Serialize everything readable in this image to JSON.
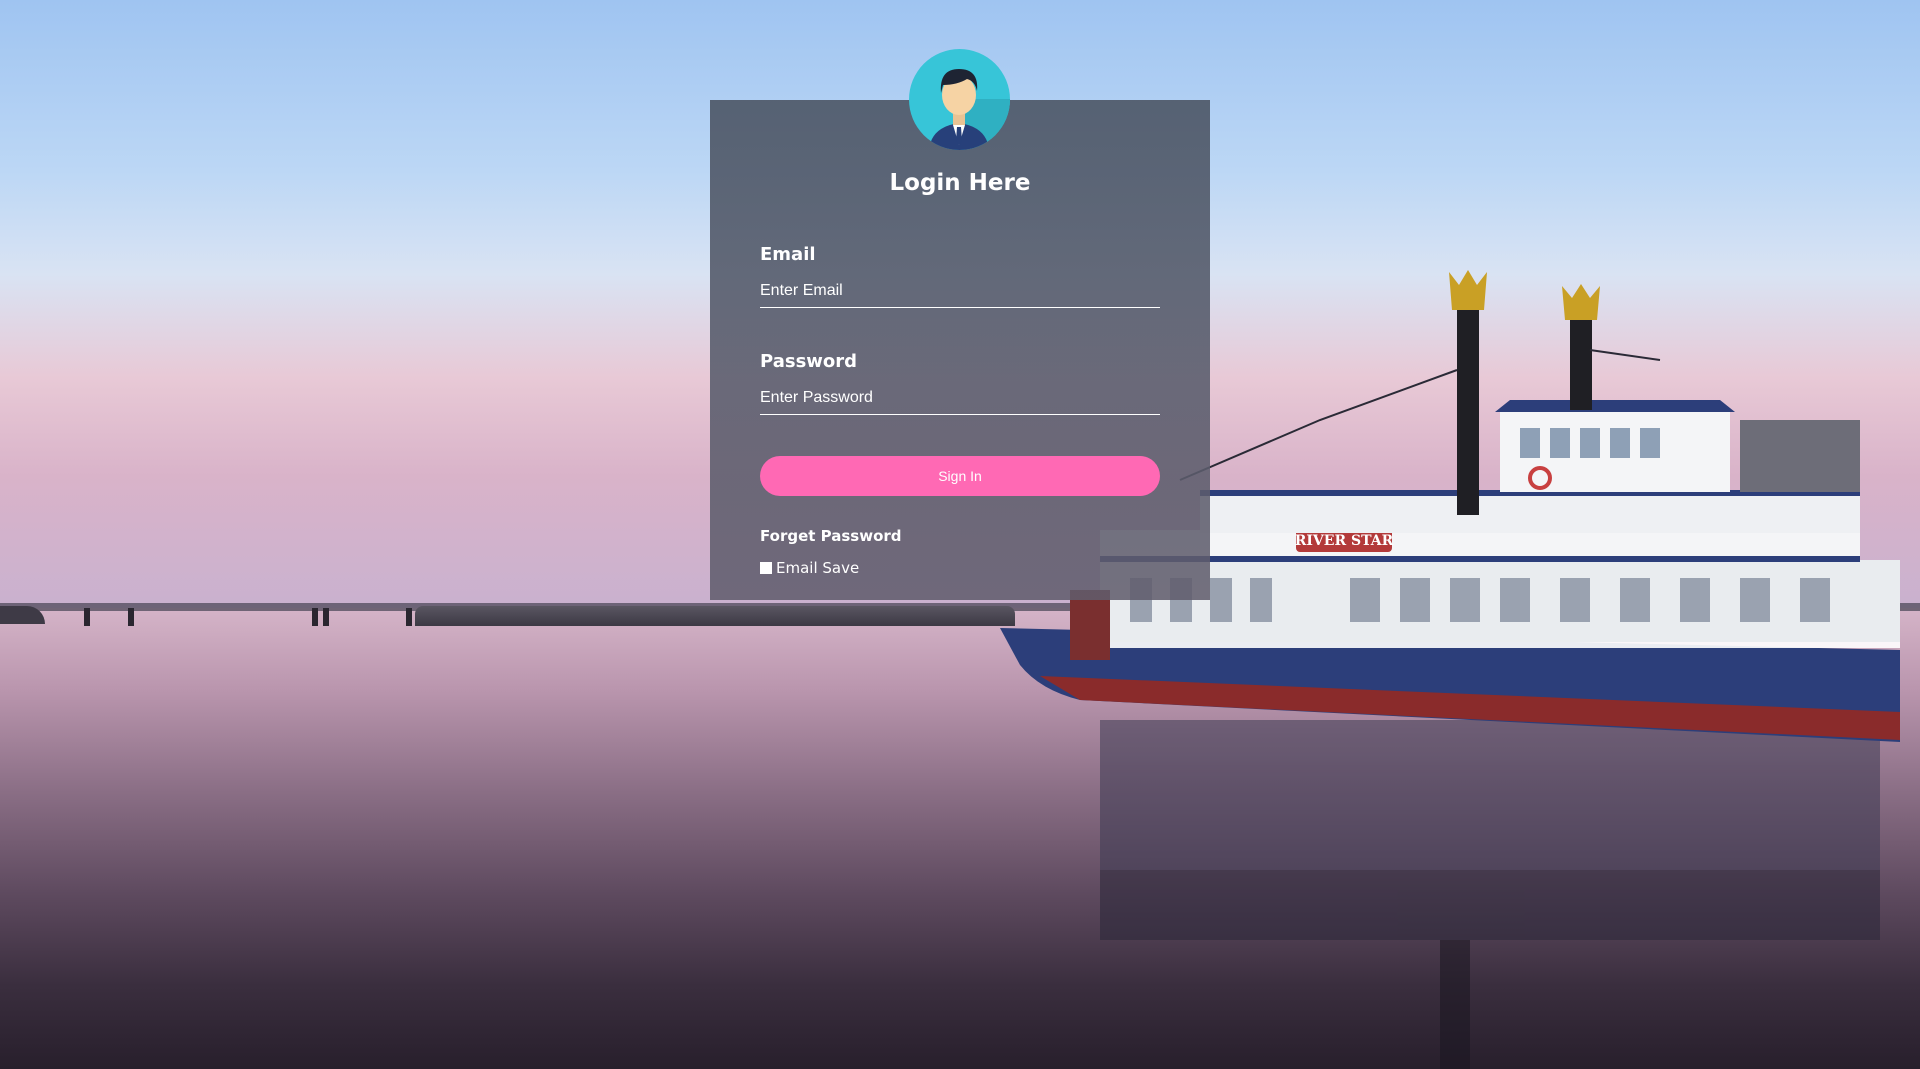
{
  "login": {
    "title": "Login Here",
    "email_label": "Email",
    "email_placeholder": "Enter Email",
    "email_value": "",
    "password_label": "Password",
    "password_placeholder": "Enter Password",
    "password_value": "",
    "signin_label": "Sign In",
    "forget_password_label": "Forget Password",
    "email_save_label": "Email Save",
    "email_save_checked": false
  },
  "background": {
    "boat_name": "RIVER STAR"
  },
  "colors": {
    "signin_button": "#ff69b4",
    "avatar_circle": "#37c5d8",
    "card_overlay": "#55596a"
  }
}
